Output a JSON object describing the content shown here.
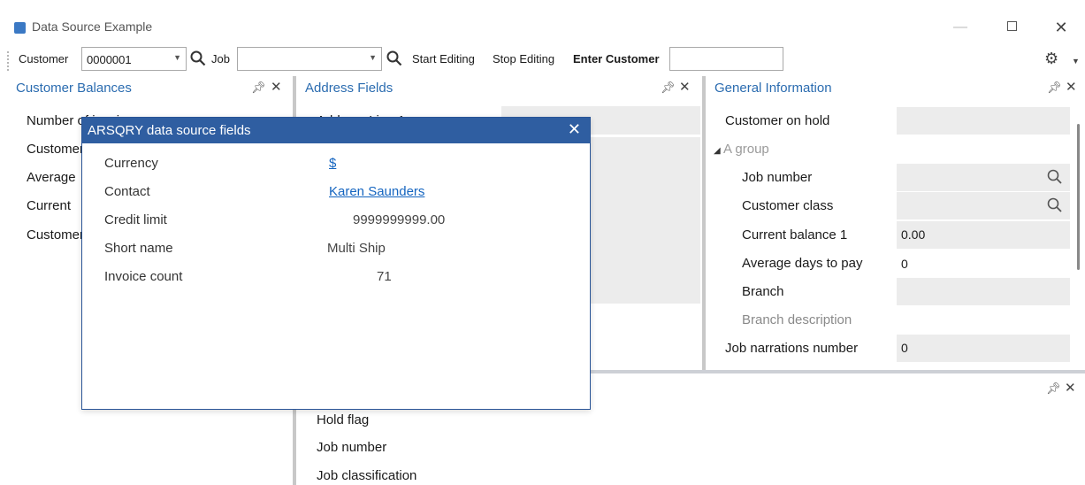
{
  "window": {
    "title": "Data Source Example"
  },
  "toolbar": {
    "customer_label": "Customer",
    "customer_value": "0000001",
    "job_label": "Job",
    "job_value": "",
    "start_editing": "Start Editing",
    "stop_editing": "Stop Editing",
    "enter_customer_label": "Enter Customer",
    "enter_customer_value": ""
  },
  "panes": {
    "customer_balances": {
      "title": "Customer Balances",
      "rows": [
        "Number of invoices",
        "Customer",
        "Average",
        "Current",
        "Customer"
      ]
    },
    "address_fields": {
      "title": "Address Fields",
      "visible_row": "Address Line 1"
    },
    "general_information": {
      "title": "General Information",
      "rows": [
        {
          "label": "Customer on hold",
          "value": ""
        },
        {
          "label": "A group",
          "value": ""
        },
        {
          "label": "Job number",
          "value": ""
        },
        {
          "label": "Customer class",
          "value": ""
        },
        {
          "label": "Current balance 1",
          "value": "0.00"
        },
        {
          "label": "Average days to pay",
          "value": "0"
        },
        {
          "label": "Branch",
          "value": ""
        },
        {
          "label": "Branch description",
          "value": ""
        },
        {
          "label": "Job narrations number",
          "value": "0"
        }
      ]
    },
    "bottom": {
      "items": [
        "Hold flag",
        "Job number",
        "Job classification"
      ]
    }
  },
  "popup": {
    "title": "ARSQRY data source fields",
    "fields": [
      {
        "label": "Currency",
        "value": "$"
      },
      {
        "label": "Contact",
        "value": "Karen Saunders"
      },
      {
        "label": "Credit limit",
        "value": "9999999999.00"
      },
      {
        "label": "Short name",
        "value": "Multi Ship"
      },
      {
        "label": "Invoice count",
        "value": "71"
      }
    ]
  },
  "colors": {
    "accent": "#2b6cb0",
    "popup_header": "#2f5ea1",
    "link": "#1565c0",
    "field_gray": "#ececec"
  }
}
